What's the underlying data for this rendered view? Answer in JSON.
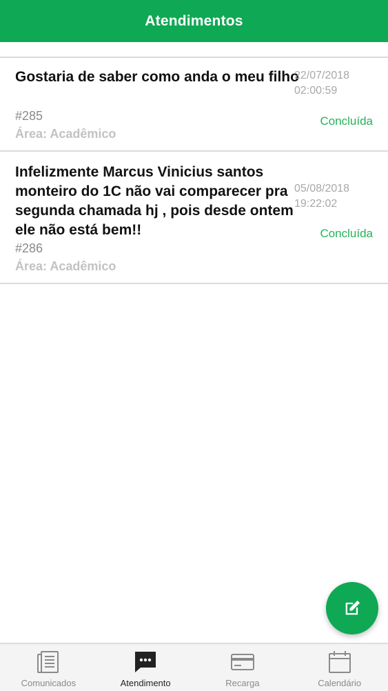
{
  "header": {
    "title": "Atendimentos"
  },
  "tickets": [
    {
      "subject": "Gostaria de saber como anda o meu filho",
      "number": "#285",
      "area": "Área: Acadêmico",
      "date": "22/07/2018",
      "time": "02:00:59",
      "status": "Concluída"
    },
    {
      "subject": "Infelizmente Marcus Vinicius santos monteiro do 1C não vai comparecer pra segunda chamada hj , pois desde ontem ele não está bem!!",
      "number": "#286",
      "area": "Área: Acadêmico",
      "date": "05/08/2018",
      "time": "19:22:02",
      "status": "Concluída"
    }
  ],
  "fab": {
    "icon": "compose-icon"
  },
  "bottom_nav": {
    "items": [
      {
        "label": "Comunicados",
        "icon": "document-icon",
        "active": false
      },
      {
        "label": "Atendimento",
        "icon": "chat-icon",
        "active": true
      },
      {
        "label": "Recarga",
        "icon": "credit-card-icon",
        "active": false
      },
      {
        "label": "Calendário",
        "icon": "calendar-icon",
        "active": false
      }
    ]
  },
  "colors": {
    "primary": "#0fa854",
    "status_green": "#22b358",
    "muted_text": "#8a8a8a"
  }
}
